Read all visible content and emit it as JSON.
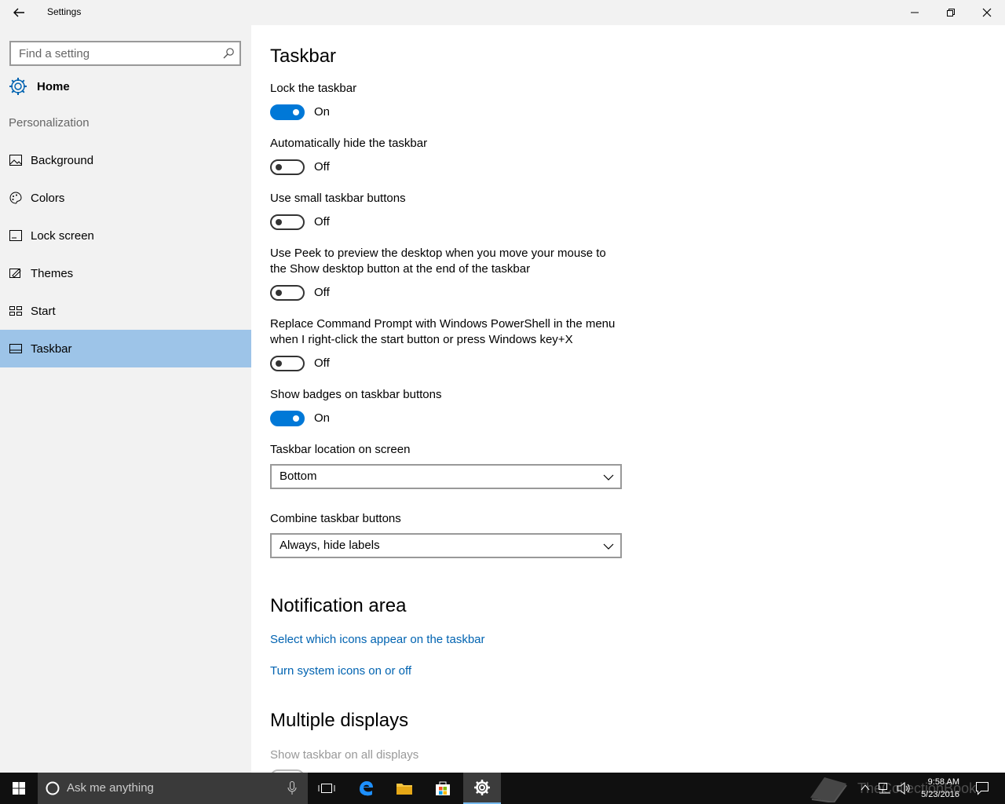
{
  "window": {
    "title": "Settings"
  },
  "sidebar": {
    "search_placeholder": "Find a setting",
    "home_label": "Home",
    "section_label": "Personalization",
    "items": [
      {
        "label": "Background",
        "icon": "picture-icon"
      },
      {
        "label": "Colors",
        "icon": "palette-icon"
      },
      {
        "label": "Lock screen",
        "icon": "lock-screen-icon"
      },
      {
        "label": "Themes",
        "icon": "themes-icon"
      },
      {
        "label": "Start",
        "icon": "start-icon"
      },
      {
        "label": "Taskbar",
        "icon": "taskbar-icon",
        "active": true
      }
    ]
  },
  "main": {
    "title": "Taskbar",
    "toggles": [
      {
        "label": "Lock the taskbar",
        "state": "On"
      },
      {
        "label": "Automatically hide the taskbar",
        "state": "Off"
      },
      {
        "label": "Use small taskbar buttons",
        "state": "Off"
      },
      {
        "label": "Use Peek to preview the desktop when you move your mouse to the Show desktop button at the end of the taskbar",
        "state": "Off"
      },
      {
        "label": "Replace Command Prompt with Windows PowerShell in the menu when I right-click the start button or press Windows key+X",
        "state": "Off"
      },
      {
        "label": "Show badges on taskbar buttons",
        "state": "On"
      }
    ],
    "location_label": "Taskbar location on screen",
    "location_value": "Bottom",
    "combine_label": "Combine taskbar buttons",
    "combine_value": "Always, hide labels",
    "notification_title": "Notification area",
    "notification_links": [
      "Select which icons appear on the taskbar",
      "Turn system icons on or off"
    ],
    "multiple_title": "Multiple displays",
    "multiple_label": "Show taskbar on all displays"
  },
  "taskbar": {
    "search_placeholder": "Ask me anything",
    "time": "9:58 AM",
    "date": "5/23/2016",
    "watermark": "TheCollectionBook"
  },
  "colors": {
    "accent": "#0078d7",
    "selection": "#9dc4e8",
    "link": "#0063b1"
  }
}
